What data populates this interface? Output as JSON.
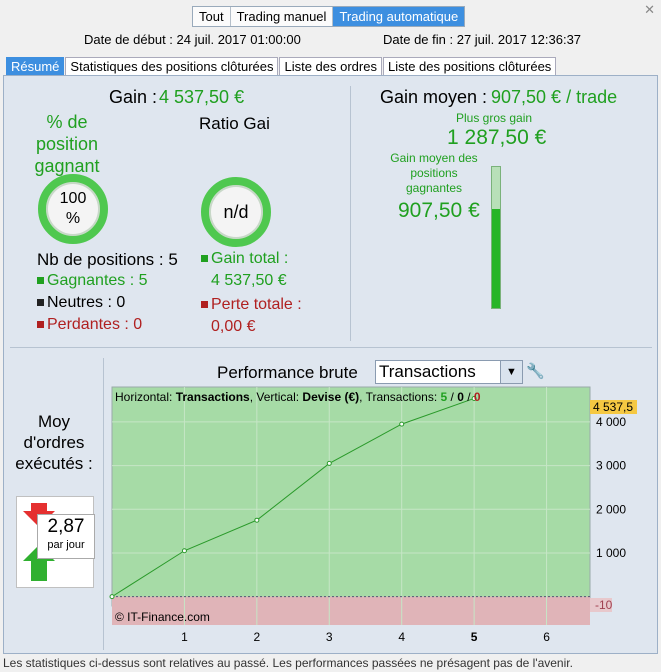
{
  "mode_tabs": [
    "Tout",
    "Trading manuel",
    "Trading automatique"
  ],
  "dates": {
    "start": "Date de début : 24 juil. 2017 01:00:00",
    "end": "Date de fin : 27 juil. 2017 12:36:37"
  },
  "sub_tabs": [
    "Résumé",
    "Statistiques des positions clôturées",
    "Liste des ordres",
    "Liste des positions clôturées"
  ],
  "summary": {
    "gain_label": "Gain :",
    "gain_value": "4 537,50 €",
    "pct_title": "% de position gagnant",
    "pct_value": "100 %",
    "ratio_title": "Ratio Gains/Pertes",
    "ratio_value": "n/d",
    "nb_positions": "Nb de positions : 5",
    "gagnantes": "Gagnantes : 5",
    "neutres": "Neutres : 0",
    "perdantes": "Perdantes : 0",
    "gain_total_label": "Gain total :",
    "gain_total_value": "4 537,50 €",
    "perte_totale_label": "Perte totale :",
    "perte_totale_value": "0,00 €"
  },
  "gain_moyen": {
    "label": "Gain moyen :",
    "value": "907,50 € / trade",
    "plus_gros_label": "Plus gros gain",
    "plus_gros_value": "1 287,50 €",
    "moyen_gagnantes_label": "Gain moyen des positions gagnantes",
    "moyen_gagnantes_value": "907,50 €",
    "bar_fill_fraction": 0.7
  },
  "performance": {
    "title": "Performance brute",
    "select_value": "Transactions",
    "info_prefix": "Horizontal: ",
    "info_h": "Transactions",
    "info_mid": ", Vertical: ",
    "info_v": "Devise (€)",
    "info_suffix": ", Transactions: ",
    "info_win": "5",
    "info_sep1": " / ",
    "info_neutral": "0",
    "info_sep2": " / ",
    "info_loss": "0",
    "watermark": "© IT-Finance.com"
  },
  "orders": {
    "title": "Moy d'ordres exécutés :",
    "value": "2,87",
    "unit": "par jour"
  },
  "footer": "Les statistiques ci-dessus sont relatives au passé. Les performances passées ne présagent pas de l'avenir.",
  "colors": {
    "accent": "#3d8fe0",
    "green": "#20a020",
    "red": "#b02020",
    "chart_bg": "#a6dba6",
    "chart_neg": "#e0b4b8"
  },
  "chart_data": {
    "type": "line",
    "x": [
      0,
      1,
      2,
      3,
      4,
      5
    ],
    "values": [
      0,
      1050,
      1750,
      3050,
      3950,
      4537.5
    ],
    "xticks": [
      "1",
      "2",
      "3",
      "4",
      "5",
      "6"
    ],
    "yticks": [
      "1 000",
      "2 000",
      "3 000",
      "4 000"
    ],
    "max_label": "4 537,5",
    "min_label": "-10",
    "xlim": [
      0,
      6.6
    ],
    "ylim": [
      -650,
      4800
    ],
    "grid": true
  }
}
